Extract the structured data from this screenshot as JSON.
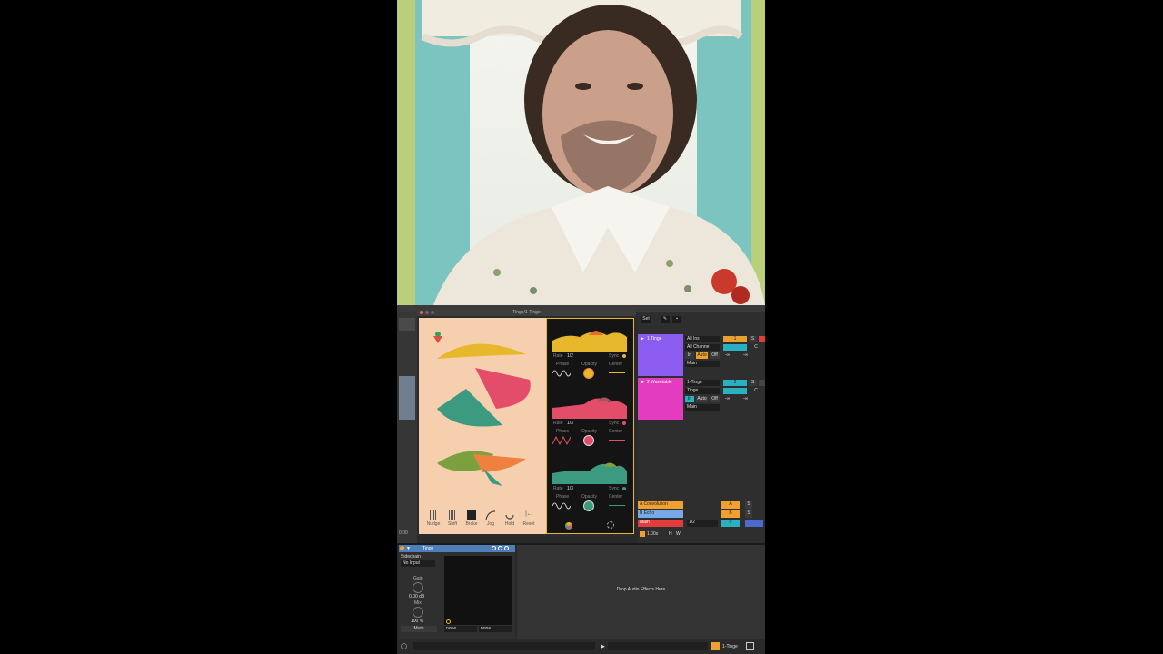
{
  "plugin_window": {
    "title": "Tinge/1-Tinge",
    "strips": [
      {
        "rate_label": "Rate",
        "rate_value": "1/2",
        "sync_label": "Sync",
        "phase_label": "Phase",
        "opacity_label": "Opacity",
        "center_label": "Center",
        "color": "#e8b82c"
      },
      {
        "rate_label": "Rate",
        "rate_value": "1/3",
        "sync_label": "Sync",
        "phase_label": "Phase",
        "opacity_label": "Opacity",
        "center_label": "Center",
        "color": "#e44d6a"
      },
      {
        "rate_label": "Rate",
        "rate_value": "1/3",
        "sync_label": "Sync",
        "phase_label": "Phase",
        "opacity_label": "Opacity",
        "center_label": "Center",
        "color": "#3c9a80"
      }
    ],
    "tools": [
      {
        "label": "Nudge",
        "icon": "nudge-icon"
      },
      {
        "label": "Shift",
        "icon": "shift-icon"
      },
      {
        "label": "Brake",
        "icon": "brake-icon"
      },
      {
        "label": "Jog",
        "icon": "jog-icon"
      },
      {
        "label": "Hold",
        "icon": "hold-icon"
      },
      {
        "label": "Reset",
        "icon": "reset-icon"
      }
    ]
  },
  "session": {
    "set_label": "Set",
    "tracks": [
      {
        "name": "1 Tinge",
        "color": "#8c5cf0",
        "input_type": "All Ins",
        "input_channel": "All Channe",
        "monitor": [
          "In",
          "Auto",
          "Off"
        ],
        "output": "Main",
        "number": "1",
        "solo": "S",
        "pan": "C",
        "volume_left": "-∞",
        "volume_right": "-∞"
      },
      {
        "name": "2 Wavetable",
        "color": "#e43cbf",
        "input_type": "1-Tinge",
        "input_channel": "Tinge",
        "monitor": [
          "In",
          "Auto",
          "Off"
        ],
        "output": "Main",
        "number": "2",
        "solo": "S",
        "pan": "C",
        "volume_left": "-∞",
        "volume_right": "-∞"
      }
    ],
    "returns": [
      {
        "name": "A Convolution",
        "color": "#f0a030",
        "letter": "A",
        "solo": "S"
      },
      {
        "name": "B Echo",
        "color": "#78a8e8",
        "letter": "B",
        "solo": "S"
      },
      {
        "name": "Main",
        "color": "#e43c3c",
        "tempo_fraction": "1/2",
        "number": "0"
      }
    ],
    "zoom": "1.00x",
    "h_label": "H",
    "w_label": "W",
    "bottom_time": "0:00"
  },
  "device": {
    "name": "Tinge",
    "sidechain_label": "Sidechain",
    "sidechain_value": "No Input",
    "gain_label": "Gain",
    "gain_value": "0.00 dB",
    "mix_label": "Mix",
    "mix_value": "100 %",
    "mute_label": "Mute",
    "route_left": "none",
    "route_right": "none",
    "drop_text": "Drop Audio Effects Here"
  },
  "status_bar": {
    "track_name": "1-Tinge"
  }
}
